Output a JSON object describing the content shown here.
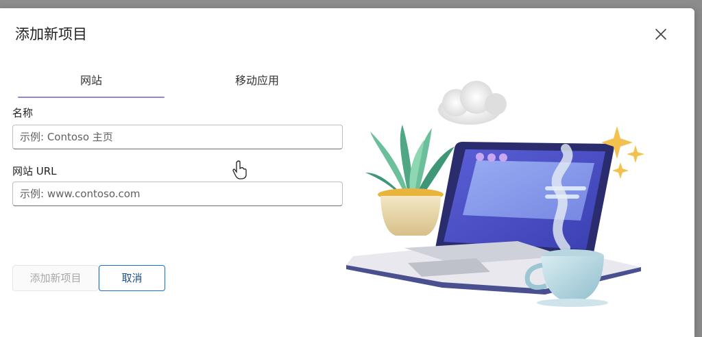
{
  "dialog": {
    "title": "添加新项目",
    "close_icon": "close-icon"
  },
  "tabs": [
    {
      "label": "网站",
      "selected": true
    },
    {
      "label": "移动应用",
      "selected": false
    }
  ],
  "form": {
    "name_label": "名称",
    "name_placeholder": "示例: Contoso 主页",
    "url_label": "网站 URL",
    "url_placeholder": "示例: www.contoso.com"
  },
  "buttons": {
    "add_label": "添加新项目",
    "cancel_label": "取消"
  },
  "colors": {
    "tab_indicator": "#8f88cf",
    "cancel_border": "#1a6fc4"
  },
  "illustration": {
    "icon": "laptop-plant-coffee-illustration"
  }
}
